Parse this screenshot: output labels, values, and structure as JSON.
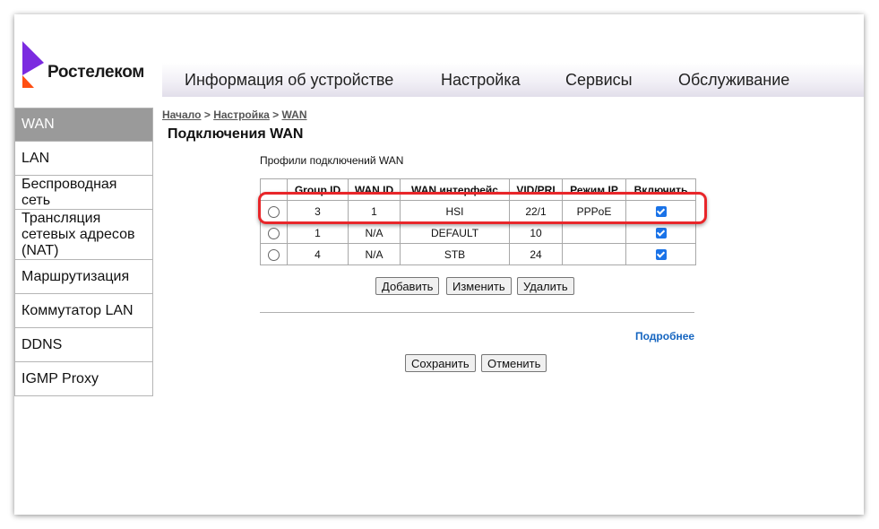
{
  "brand": {
    "name": "Ростелеком",
    "colors": {
      "purple": "#7b2be0",
      "orange": "#ff4f12"
    }
  },
  "topnav": {
    "items": [
      {
        "label": "Информация об устройстве"
      },
      {
        "label": "Настройка"
      },
      {
        "label": "Сервисы"
      },
      {
        "label": "Обслуживание"
      }
    ]
  },
  "sidebar": {
    "items": [
      {
        "label": "WAN",
        "active": true
      },
      {
        "label": "LAN"
      },
      {
        "label": "Беспроводная сеть"
      },
      {
        "label": "Трансляция сетевых адресов (NAT)"
      },
      {
        "label": "Маршрутизация"
      },
      {
        "label": "Коммутатор LAN"
      },
      {
        "label": "DDNS"
      },
      {
        "label": "IGMP Proxy"
      }
    ]
  },
  "breadcrumb": {
    "items": [
      "Начало",
      "Настройка",
      "WAN"
    ],
    "separator": ">"
  },
  "page": {
    "title": "Подключения WAN",
    "section_label": "Профили подключений WAN"
  },
  "table": {
    "headers": [
      "",
      "Group ID",
      "WAN ID",
      "WAN интерфейс",
      "VID/PRI",
      "Режим IP",
      "Включить"
    ],
    "rows": [
      {
        "group_id": "3",
        "wan_id": "1",
        "interface": "HSI",
        "vid_pri": "22/1",
        "ip_mode": "PPPoE",
        "enabled": true
      },
      {
        "group_id": "1",
        "wan_id": "N/A",
        "interface": "DEFAULT",
        "vid_pri": "10",
        "ip_mode": "",
        "enabled": true
      },
      {
        "group_id": "4",
        "wan_id": "N/A",
        "interface": "STB",
        "vid_pri": "24",
        "ip_mode": "",
        "enabled": true
      }
    ]
  },
  "actions": {
    "add": "Добавить",
    "edit": "Изменить",
    "delete": "Удалить",
    "more": "Подробнее",
    "save": "Сохранить",
    "cancel": "Отменить"
  },
  "annotation": {
    "color": "#e8262a"
  }
}
